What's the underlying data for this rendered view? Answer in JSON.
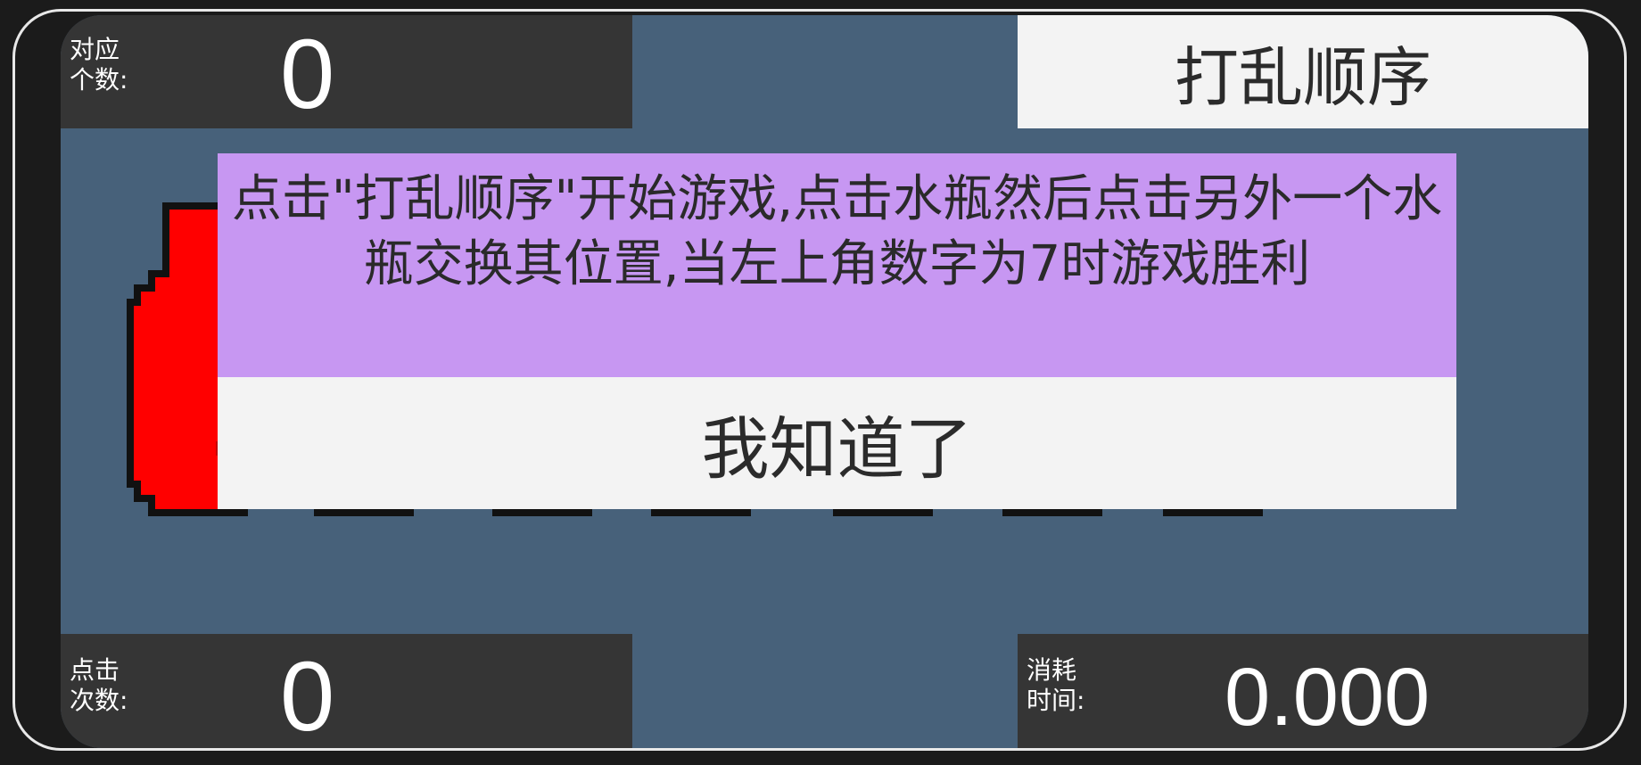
{
  "stats": {
    "match_label": "对应\n个数:",
    "match_value": "0",
    "clicks_label": "点击\n次数:",
    "clicks_value": "0",
    "time_label": "消耗\n时间:",
    "time_value": "0.000"
  },
  "shuffle_button": "打乱顺序",
  "dialog": {
    "message": "点击\"打乱顺序\"开始游戏,点击水瓶然后点击另外一个水瓶交换其位置,当左上角数字为7时游戏胜利",
    "ok_button": "我知道了"
  },
  "bottles": [
    {
      "name": "red",
      "color": "#ff0000",
      "dot": "#c40000"
    },
    {
      "name": "purple",
      "color": "#8a00ff",
      "dot": "#6a00c4"
    },
    {
      "name": "cyan",
      "color": "#00ffff",
      "dot": "#00c4c4"
    },
    {
      "name": "yellow",
      "color": "#ffff00",
      "dot": "#c4c400"
    },
    {
      "name": "orange",
      "color": "#ffa500",
      "dot": "#c47f00"
    },
    {
      "name": "green",
      "color": "#00ff00",
      "dot": "#00c400"
    },
    {
      "name": "blue",
      "color": "#0019ff",
      "dot": "#0012c4"
    }
  ]
}
